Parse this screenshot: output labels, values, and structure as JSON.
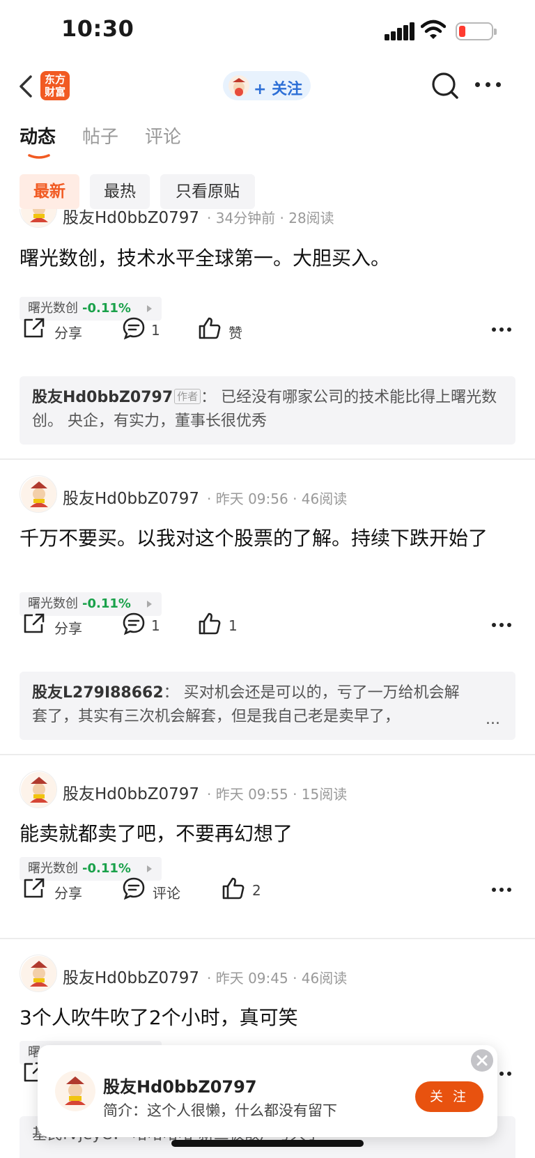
{
  "status_bar": {
    "time": "10:30"
  },
  "nav": {
    "logo_text": "东方财富",
    "follow_label": "+ 关注"
  },
  "tabs": [
    {
      "label": "动态",
      "active": true
    },
    {
      "label": "帖子",
      "active": false
    },
    {
      "label": "评论",
      "active": false
    }
  ],
  "filters": [
    {
      "label": "最新",
      "active": true
    },
    {
      "label": "最热",
      "active": false
    },
    {
      "label": "只看原贴",
      "active": false
    }
  ],
  "actions": {
    "share_label": "分享"
  },
  "posts": [
    {
      "author": "股友Hd0bbZ0797",
      "meta": "· 34分钟前 · 28阅读",
      "content": "曙光数创，技术水平全球第一。大胆买入。",
      "stock": {
        "name": "曙光数创",
        "change": "-0.11%"
      },
      "comment_count": "1",
      "like_label": "赞",
      "comment": {
        "author": "股友Hd0bbZ0797",
        "badge": "作者",
        "text": "：  已经没有哪家公司的技术能比得上曙光数创。  央企，有实力，董事长很优秀"
      }
    },
    {
      "author": "股友Hd0bbZ0797",
      "meta": "· 昨天 09:56 · 46阅读",
      "content": "千万不要买。以我对这个股票的了解。持续下跌开始了",
      "stock": {
        "name": "曙光数创",
        "change": "-0.11%"
      },
      "comment_count": "1",
      "like_label": "1",
      "comment": {
        "author": "股友L279I88662",
        "text": "：  买对机会还是可以的，亏了一万给机会解套了，其实有三次机会解套，但是我自己老是卖早了，",
        "ellipsis": "..."
      }
    },
    {
      "author": "股友Hd0bbZ0797",
      "meta": "· 昨天 09:55 · 15阅读",
      "content": "能卖就都卖了吧，不要再幻想了",
      "stock": {
        "name": "曙光数创",
        "change": "-0.11%"
      },
      "comment_label": "评论",
      "like_label": "2"
    },
    {
      "author": "股友Hd0bbZ0797",
      "meta": "· 昨天 09:45 · 46阅读",
      "content": "3个人吹牛吹了2个小时，真可笑",
      "stock_partial": "曙",
      "comment_partial": "基民fVjeyC： 哈哈哈哈 新三板散户亏大了"
    }
  ],
  "popup": {
    "name": "股友Hd0bbZ0797",
    "bio": "简介：这个人很懒，什么都没有留下",
    "follow_button": "关 注"
  }
}
